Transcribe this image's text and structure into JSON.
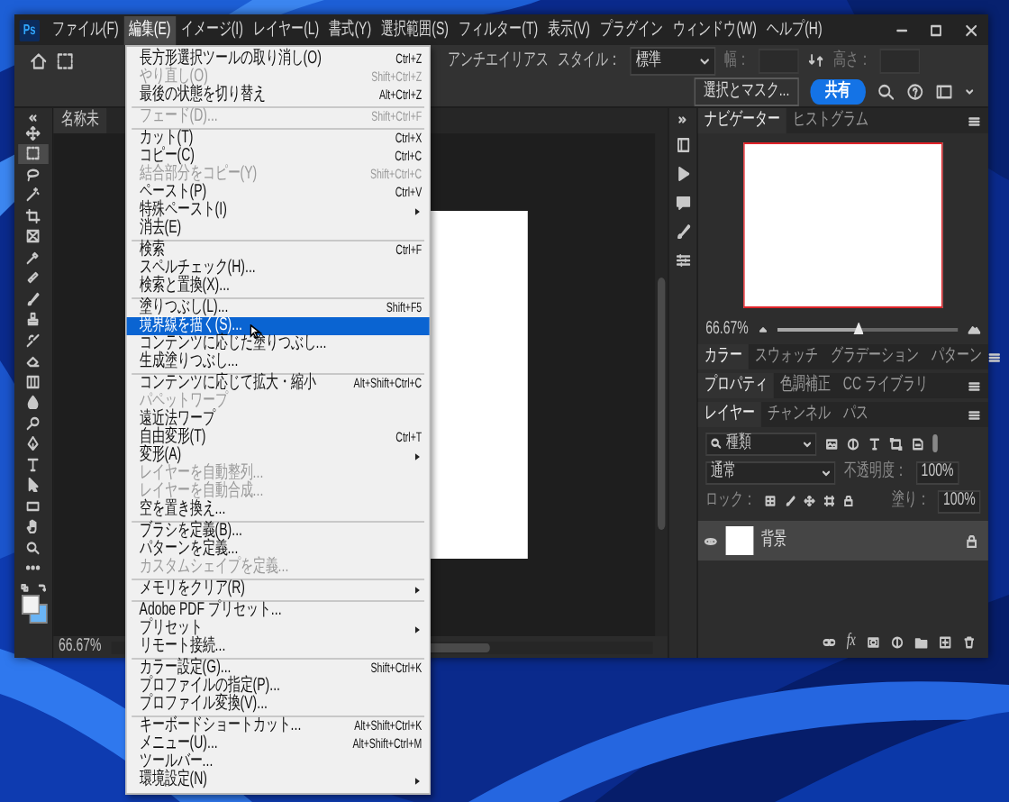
{
  "logo": "Ps",
  "menu_bar": [
    {
      "label": "ファイル(F)",
      "selected": false
    },
    {
      "label": "編集(E)",
      "selected": true
    },
    {
      "label": "イメージ(I)",
      "selected": false
    },
    {
      "label": "レイヤー(L)",
      "selected": false
    },
    {
      "label": "書式(Y)",
      "selected": false
    },
    {
      "label": "選択範囲(S)",
      "selected": false
    },
    {
      "label": "フィルター(T)",
      "selected": false
    },
    {
      "label": "表示(V)",
      "selected": false
    },
    {
      "label": "プラグイン",
      "selected": false
    },
    {
      "label": "ウィンドウ(W)",
      "selected": false
    },
    {
      "label": "ヘルプ(H)",
      "selected": false
    }
  ],
  "options_bar": {
    "anti_alias": "アンチエイリアス",
    "style_label": "スタイル：",
    "style_value": "標準",
    "width_field": {
      "label": "幅：",
      "disabled": true
    },
    "height_field": {
      "label": "高さ：",
      "disabled": true
    },
    "mask_button": "選択とマスク...",
    "share_button": "共有"
  },
  "document_tab": "名称未",
  "tools": [
    {
      "selected": false
    },
    {
      "selected": true
    },
    {
      "selected": false
    },
    {
      "selected": false
    },
    {
      "selected": false
    },
    {
      "selected": false
    },
    {
      "selected": false
    },
    {
      "selected": false
    },
    {
      "selected": false
    },
    {
      "selected": false
    },
    {
      "selected": false
    },
    {
      "selected": false
    },
    {
      "selected": false
    },
    {
      "selected": false
    },
    {
      "selected": false
    },
    {
      "selected": false
    },
    {
      "selected": false
    },
    {
      "selected": false
    },
    {
      "selected": false
    },
    {
      "selected": false
    },
    {
      "selected": false
    },
    {
      "selected": false
    }
  ],
  "edit_menu": [
    {
      "kind": "item",
      "label": "長方形選択ツールの取り消し(O)",
      "shortcut": "Ctrl+Z",
      "disabled": false,
      "submenu": false,
      "selected": false
    },
    {
      "kind": "item",
      "label": "やり直し(O)",
      "shortcut": "Shift+Ctrl+Z",
      "disabled": true,
      "submenu": false,
      "selected": false
    },
    {
      "kind": "item",
      "label": "最後の状態を切り替え",
      "shortcut": "Alt+Ctrl+Z",
      "disabled": false,
      "submenu": false,
      "selected": false
    },
    {
      "kind": "separator"
    },
    {
      "kind": "item",
      "label": "フェード(D)...",
      "shortcut": "Shift+Ctrl+F",
      "disabled": true,
      "submenu": false,
      "selected": false
    },
    {
      "kind": "separator"
    },
    {
      "kind": "item",
      "label": "カット(T)",
      "shortcut": "Ctrl+X",
      "disabled": false,
      "submenu": false,
      "selected": false
    },
    {
      "kind": "item",
      "label": "コピー(C)",
      "shortcut": "Ctrl+C",
      "disabled": false,
      "submenu": false,
      "selected": false
    },
    {
      "kind": "item",
      "label": "結合部分をコピー(Y)",
      "shortcut": "Shift+Ctrl+C",
      "disabled": true,
      "submenu": false,
      "selected": false
    },
    {
      "kind": "item",
      "label": "ペースト(P)",
      "shortcut": "Ctrl+V",
      "disabled": false,
      "submenu": false,
      "selected": false
    },
    {
      "kind": "item",
      "label": "特殊ペースト(I)",
      "disabled": false,
      "submenu": true,
      "selected": false
    },
    {
      "kind": "item",
      "label": "消去(E)",
      "disabled": false,
      "submenu": false,
      "selected": false
    },
    {
      "kind": "separator"
    },
    {
      "kind": "item",
      "label": "検索",
      "shortcut": "Ctrl+F",
      "disabled": false,
      "submenu": false,
      "selected": false
    },
    {
      "kind": "item",
      "label": "スペルチェック(H)...",
      "disabled": false,
      "submenu": false,
      "selected": false
    },
    {
      "kind": "item",
      "label": "検索と置換(X)...",
      "disabled": false,
      "submenu": false,
      "selected": false
    },
    {
      "kind": "separator"
    },
    {
      "kind": "item",
      "label": "塗りつぶし(L)...",
      "shortcut": "Shift+F5",
      "disabled": false,
      "submenu": false,
      "selected": false
    },
    {
      "kind": "item",
      "label": "境界線を描く(S)...",
      "disabled": false,
      "submenu": false,
      "selected": true
    },
    {
      "kind": "item",
      "label": "コンテンツに応じた塗りつぶし...",
      "disabled": false,
      "submenu": false,
      "selected": false
    },
    {
      "kind": "item",
      "label": "生成塗りつぶし...",
      "disabled": false,
      "submenu": false,
      "selected": false
    },
    {
      "kind": "separator"
    },
    {
      "kind": "item",
      "label": "コンテンツに応じて拡大・縮小",
      "shortcut": "Alt+Shift+Ctrl+C",
      "disabled": false,
      "submenu": false,
      "selected": false
    },
    {
      "kind": "item",
      "label": "パペットワープ",
      "disabled": true,
      "submenu": false,
      "selected": false
    },
    {
      "kind": "item",
      "label": "遠近法ワープ",
      "disabled": false,
      "submenu": false,
      "selected": false
    },
    {
      "kind": "item",
      "label": "自由変形(T)",
      "shortcut": "Ctrl+T",
      "disabled": false,
      "submenu": false,
      "selected": false
    },
    {
      "kind": "item",
      "label": "変形(A)",
      "disabled": false,
      "submenu": true,
      "selected": false
    },
    {
      "kind": "item",
      "label": "レイヤーを自動整列...",
      "disabled": true,
      "submenu": false,
      "selected": false
    },
    {
      "kind": "item",
      "label": "レイヤーを自動合成...",
      "disabled": true,
      "submenu": false,
      "selected": false
    },
    {
      "kind": "item",
      "label": "空を置き換え...",
      "disabled": false,
      "submenu": false,
      "selected": false
    },
    {
      "kind": "separator"
    },
    {
      "kind": "item",
      "label": "ブラシを定義(B)...",
      "disabled": false,
      "submenu": false,
      "selected": false
    },
    {
      "kind": "item",
      "label": "パターンを定義...",
      "disabled": false,
      "submenu": false,
      "selected": false
    },
    {
      "kind": "item",
      "label": "カスタムシェイプを定義...",
      "disabled": true,
      "submenu": false,
      "selected": false
    },
    {
      "kind": "separator"
    },
    {
      "kind": "item",
      "label": "メモリをクリア(R)",
      "disabled": false,
      "submenu": true,
      "selected": false
    },
    {
      "kind": "separator"
    },
    {
      "kind": "item",
      "label": "Adobe PDF プリセット...",
      "disabled": false,
      "submenu": false,
      "selected": false
    },
    {
      "kind": "item",
      "label": "プリセット",
      "disabled": false,
      "submenu": true,
      "selected": false
    },
    {
      "kind": "item",
      "label": "リモート接続...",
      "disabled": false,
      "submenu": false,
      "selected": false
    },
    {
      "kind": "separator"
    },
    {
      "kind": "item",
      "label": "カラー設定(G)...",
      "shortcut": "Shift+Ctrl+K",
      "disabled": false,
      "submenu": false,
      "selected": false
    },
    {
      "kind": "item",
      "label": "プロファイルの指定(P)...",
      "disabled": false,
      "submenu": false,
      "selected": false
    },
    {
      "kind": "item",
      "label": "プロファイル変換(V)...",
      "disabled": false,
      "submenu": false,
      "selected": false
    },
    {
      "kind": "separator"
    },
    {
      "kind": "item",
      "label": "キーボードショートカット...",
      "shortcut": "Alt+Shift+Ctrl+K",
      "disabled": false,
      "submenu": false,
      "selected": false
    },
    {
      "kind": "item",
      "label": "メニュー(U)...",
      "shortcut": "Alt+Shift+Ctrl+M",
      "disabled": false,
      "submenu": false,
      "selected": false
    },
    {
      "kind": "item",
      "label": "ツールバー...",
      "disabled": false,
      "submenu": false,
      "selected": false
    },
    {
      "kind": "item",
      "label": "環境設定(N)",
      "disabled": false,
      "submenu": true,
      "selected": false
    }
  ],
  "status_zoom": "66.67%",
  "navigator": {
    "tabs": [
      {
        "label": "ナビゲーター",
        "selected": true
      },
      {
        "label": "ヒストグラム",
        "selected": false
      }
    ],
    "zoom": "66.67%",
    "level": 0.45
  },
  "color_panel": {
    "tabs": [
      {
        "label": "カラー",
        "selected": true
      },
      {
        "label": "スウォッチ",
        "selected": false
      },
      {
        "label": "グラデーション",
        "selected": false
      },
      {
        "label": "パターン",
        "selected": false
      }
    ]
  },
  "properties_panel": {
    "tabs": [
      {
        "label": "プロパティ",
        "selected": true
      },
      {
        "label": "色調補正",
        "selected": false
      },
      {
        "label": "CC ライブラリ",
        "selected": false
      }
    ]
  },
  "layers_panel": {
    "tabs": [
      {
        "label": "レイヤー",
        "selected": true
      },
      {
        "label": "チャンネル",
        "selected": false
      },
      {
        "label": "パス",
        "selected": false
      }
    ],
    "filter": "種類",
    "blend_mode": "通常",
    "opacity_label": "不透明度：",
    "opacity": "100%",
    "lock_label": "ロック：",
    "fill_label": "塗り：",
    "fill": "100%",
    "layers": [
      {
        "name": "背景",
        "visible": true,
        "locked": true,
        "selected": true
      }
    ],
    "effects_button": "fx"
  }
}
